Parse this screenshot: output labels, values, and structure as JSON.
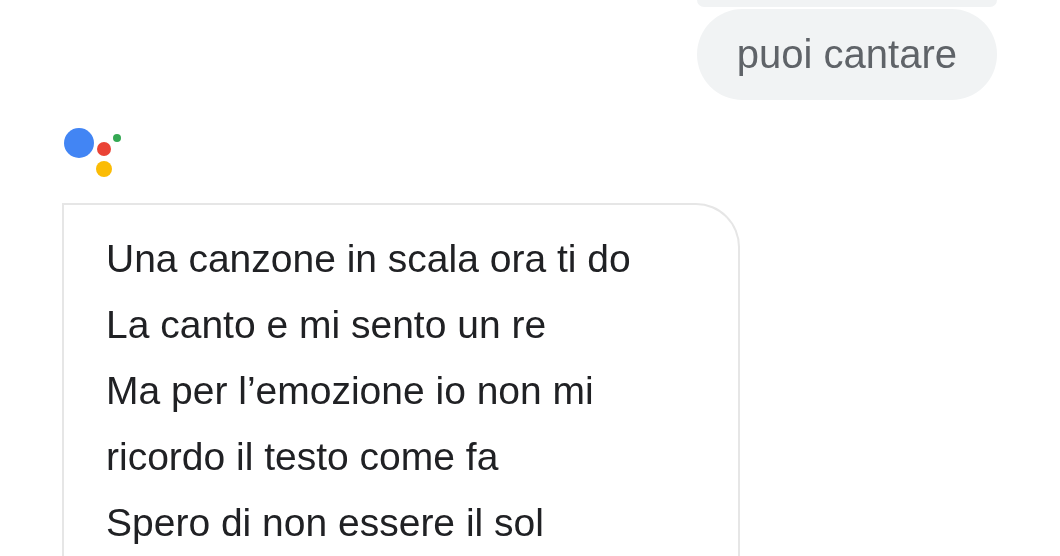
{
  "messages": [
    {
      "kind": "user",
      "text": "puoi cantare"
    },
    {
      "kind": "assistant",
      "lines": [
        "Una canzone in scala ora ti do",
        "La canto e mi sento un re",
        "Ma per l’emozione io non mi",
        "ricordo il testo come fa",
        "Spero di non essere il sol"
      ]
    }
  ]
}
